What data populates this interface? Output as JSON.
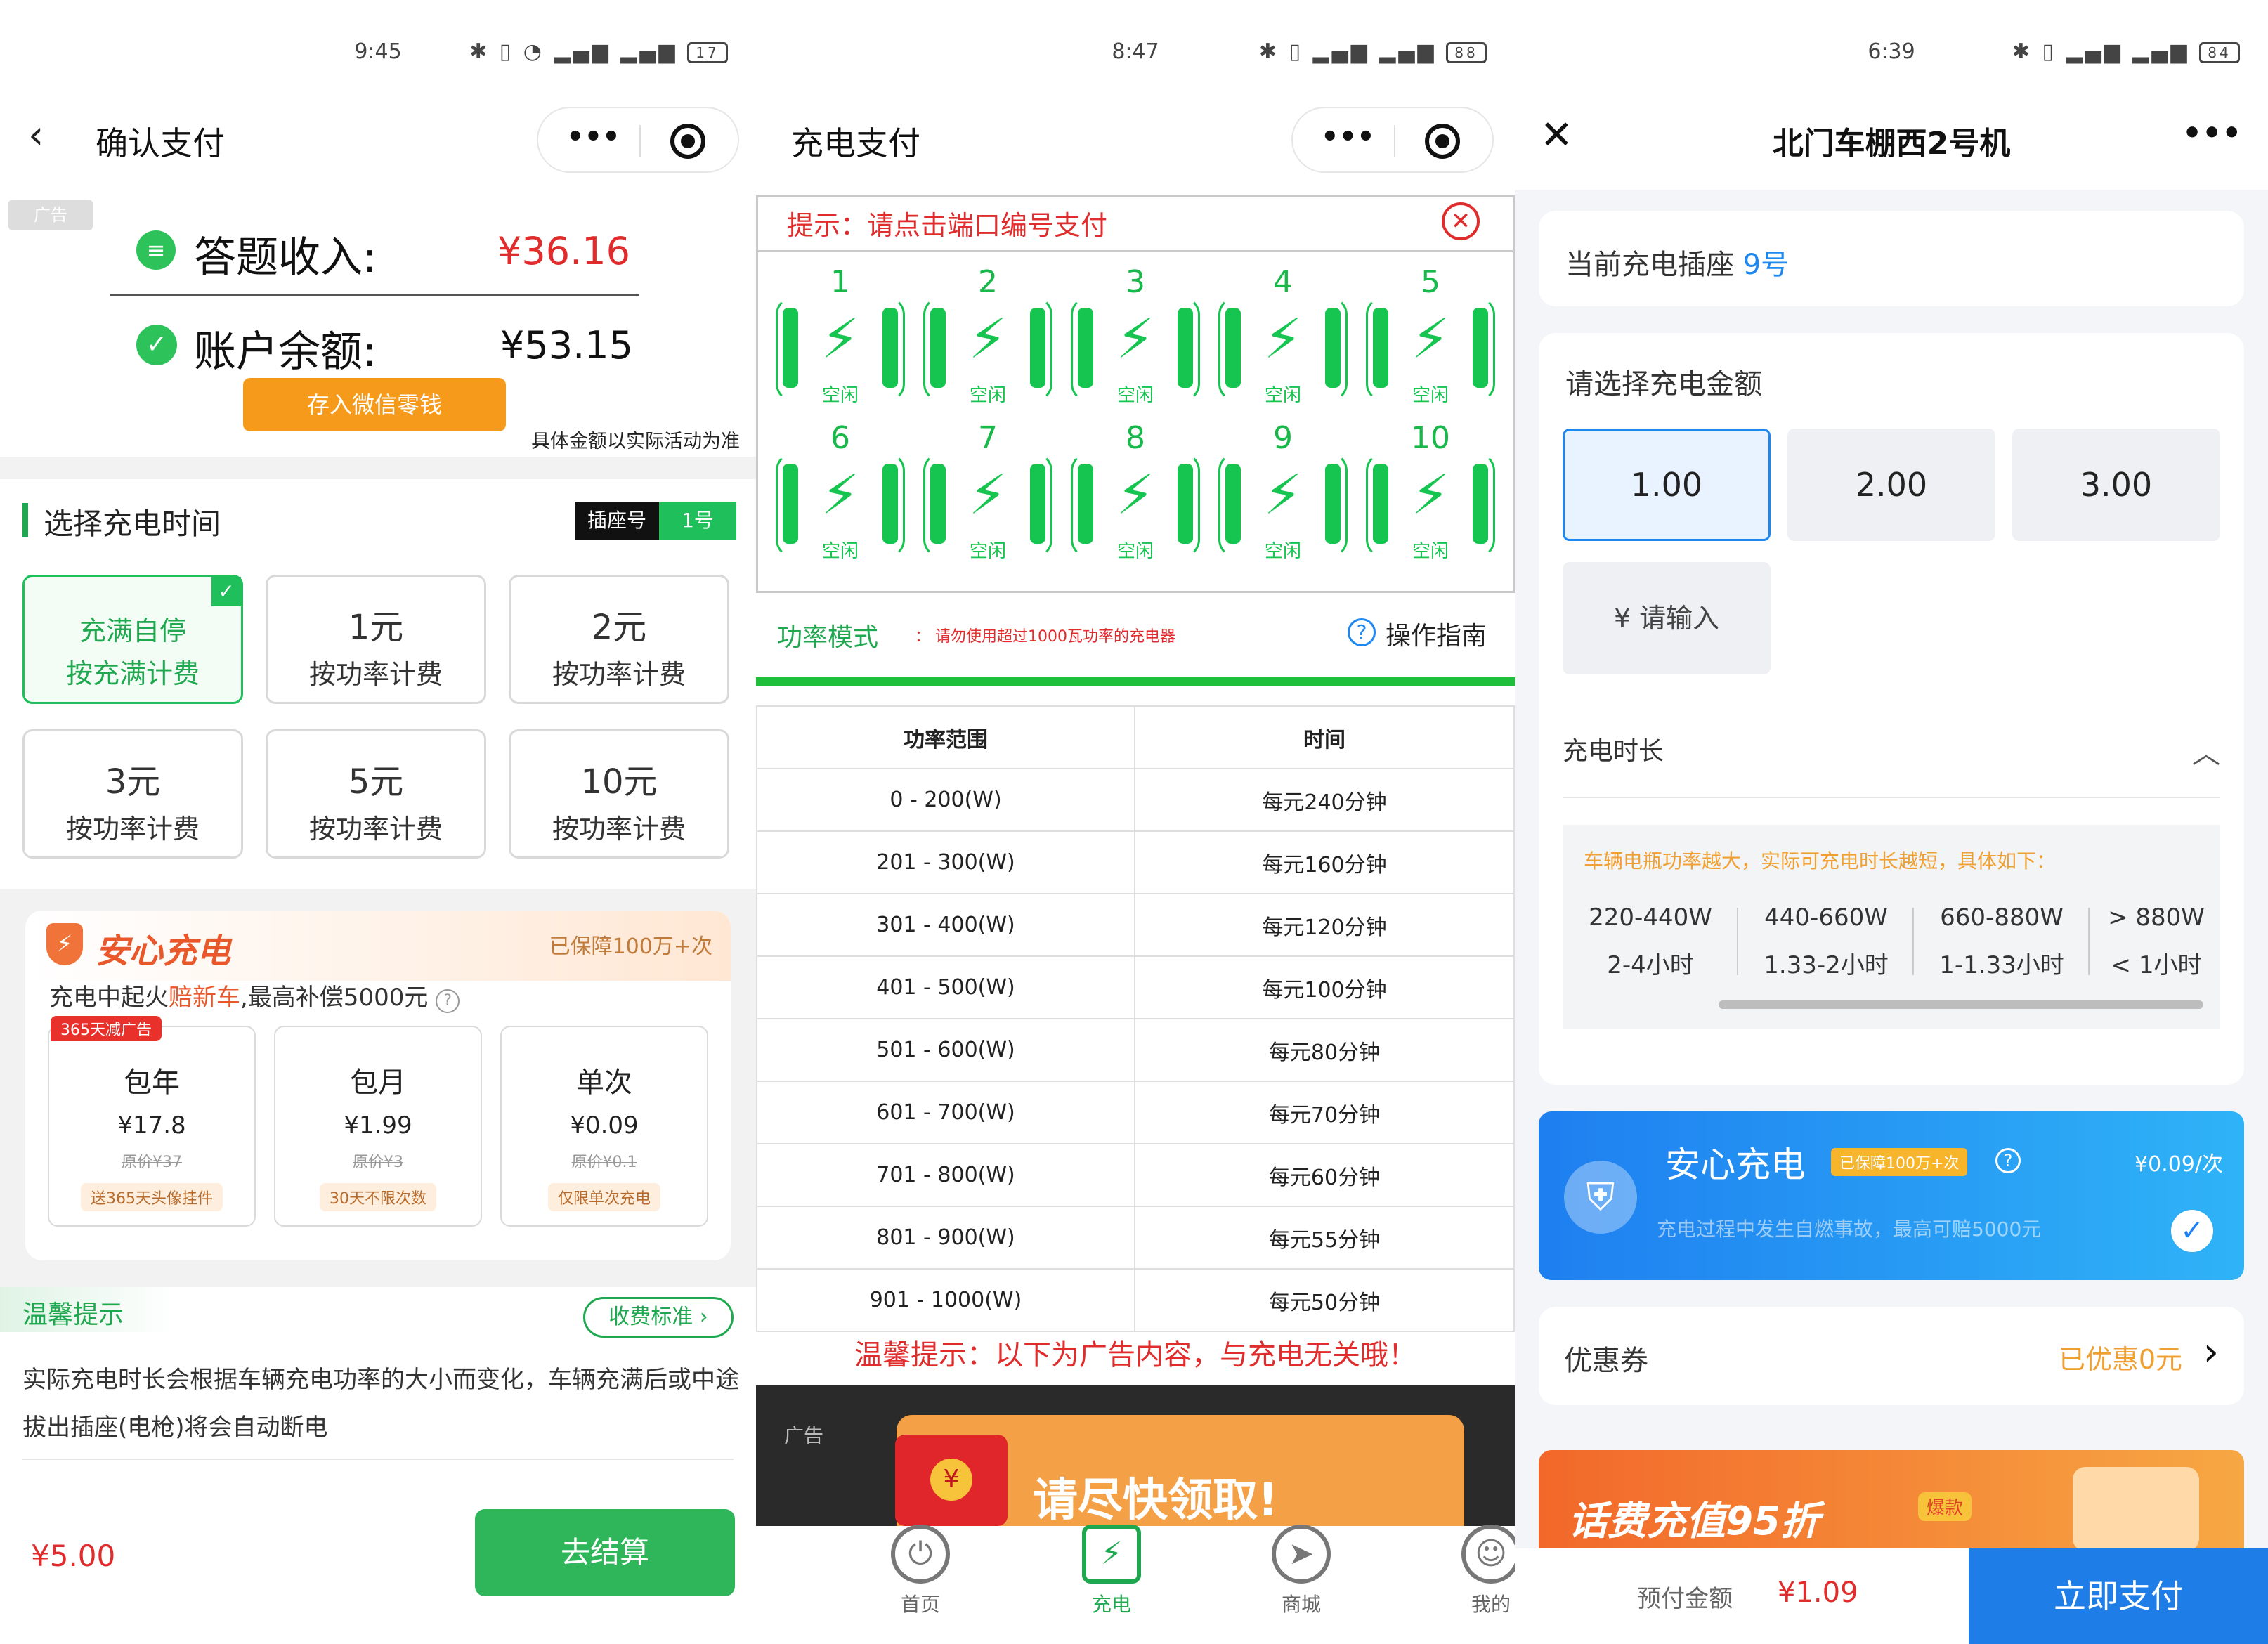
{
  "p1": {
    "status_time": "9:45",
    "battery": "17",
    "title": "确认支付",
    "ad_tag": "广告",
    "income_label": "答题收入:",
    "income_value": "¥36.16",
    "balance_label": "账户余额:",
    "balance_value": "¥53.15",
    "deposit_btn": "存入微信零钱",
    "disclaimer": "具体金额以实际活动为准",
    "section_title": "选择充电时间",
    "socket_label": "插座号",
    "socket_value": "1号",
    "options": [
      {
        "l1": "充满自停",
        "l2": "按充满计费"
      },
      {
        "l1": "1元",
        "l2": "按功率计费"
      },
      {
        "l1": "2元",
        "l2": "按功率计费"
      },
      {
        "l1": "3元",
        "l2": "按功率计费"
      },
      {
        "l1": "5元",
        "l2": "按功率计费"
      },
      {
        "l1": "10元",
        "l2": "按功率计费"
      }
    ],
    "insurance_brand": "安心充电",
    "insurance_badge": "已保障100万+次",
    "insurance_desc_a": "充电中起火",
    "insurance_desc_b": "赔新车",
    "insurance_desc_c": ",最高补偿5000元",
    "plan_tag": "365天减广告",
    "plans": [
      {
        "name": "包年",
        "price": "¥17.8",
        "orig": "原价¥37",
        "tag": "送365天头像挂件"
      },
      {
        "name": "包月",
        "price": "¥1.99",
        "orig": "原价¥3",
        "tag": "30天不限次数"
      },
      {
        "name": "单次",
        "price": "¥0.09",
        "orig": "原价¥0.1",
        "tag": "仅限单次充电"
      }
    ],
    "tips_title": "温馨提示",
    "fee_btn": "收费标准",
    "tips_text": "实际充电时长会根据车辆充电功率的大小而变化，车辆充满后或中途拔出插座(电枪)将会自动断电",
    "total": "¥5.00",
    "checkout_btn": "去结算"
  },
  "p2": {
    "status_time": "8:47",
    "battery": "88",
    "title": "充电支付",
    "hint": "提示：请点击端口编号支付",
    "ports": [
      {
        "n": "1",
        "s": "空闲"
      },
      {
        "n": "2",
        "s": "空闲"
      },
      {
        "n": "3",
        "s": "空闲"
      },
      {
        "n": "4",
        "s": "空闲"
      },
      {
        "n": "5",
        "s": "空闲"
      },
      {
        "n": "6",
        "s": "空闲"
      },
      {
        "n": "7",
        "s": "空闲"
      },
      {
        "n": "8",
        "s": "空闲"
      },
      {
        "n": "9",
        "s": "空闲"
      },
      {
        "n": "10",
        "s": "空闲"
      }
    ],
    "mode_label": "功率模式",
    "mode_warn": "请勿使用超过1000瓦功率的充电器",
    "guide": "操作指南",
    "table_head": [
      "功率范围",
      "时间"
    ],
    "table_rows": [
      [
        "0 - 200(W)",
        "每元240分钟"
      ],
      [
        "201 - 300(W)",
        "每元160分钟"
      ],
      [
        "301 - 400(W)",
        "每元120分钟"
      ],
      [
        "401 - 500(W)",
        "每元100分钟"
      ],
      [
        "501 - 600(W)",
        "每元80分钟"
      ],
      [
        "601 - 700(W)",
        "每元70分钟"
      ],
      [
        "701 - 800(W)",
        "每元60分钟"
      ],
      [
        "801 - 900(W)",
        "每元55分钟"
      ],
      [
        "901 - 1000(W)",
        "每元50分钟"
      ]
    ],
    "ad_notice": "温馨提示：以下为广告内容，与充电无关哦！",
    "ad_tag": "广告",
    "ad_text": "请尽快领取!",
    "nav": [
      "首页",
      "充电",
      "商城",
      "我的"
    ]
  },
  "p3": {
    "status_time": "6:39",
    "battery": "84",
    "title": "北门车棚西2号机",
    "socket_label": "当前充电插座",
    "socket_value": "9号",
    "amount_title": "请选择充电金额",
    "amounts": [
      "1.00",
      "2.00",
      "3.00"
    ],
    "amount_input": "¥ 请输入",
    "duration_label": "充电时长",
    "duration_note": "车辆电瓶功率越大，实际可充电时长越短，具体如下：",
    "slabs": [
      {
        "w": "220-440W",
        "t": "2-4小时"
      },
      {
        "w": "440-660W",
        "t": "1.33-2小时"
      },
      {
        "w": "660-880W",
        "t": "1-1.33小时"
      },
      {
        "w": "> 880W",
        "t": "< 1小时"
      }
    ],
    "ins_title": "安心充电",
    "ins_badge": "已保障100万+次",
    "ins_price": "¥0.09/次",
    "ins_desc": "充电过程中发生自燃事故，最高可赔5000元",
    "coupon_label": "优惠券",
    "coupon_value": "已优惠0元",
    "ad_text": "话费充值95折",
    "ad_badge": "爆款",
    "prepay_label": "预付金额",
    "prepay_value": "¥1.09",
    "pay_btn": "立即支付"
  },
  "colors": {
    "green": "#1fa84f",
    "red": "#e02c2c",
    "orange": "#f59a1b",
    "blue": "#1e88f0",
    "pay_blue": "#1f7de8"
  }
}
